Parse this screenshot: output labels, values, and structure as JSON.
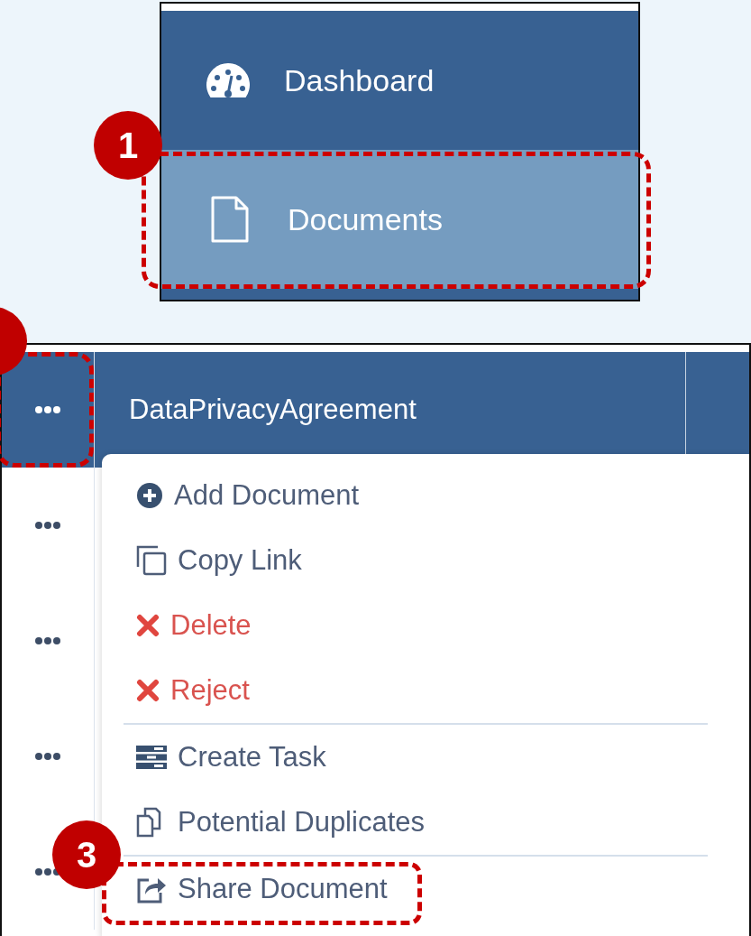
{
  "nav": {
    "items": [
      {
        "label": "Dashboard",
        "selected": false
      },
      {
        "label": "Documents",
        "selected": true,
        "callout": "1"
      }
    ]
  },
  "table": {
    "rows": [
      {
        "selected": true,
        "highlighted": true,
        "name": "DataPrivacyAgreement"
      },
      {
        "selected": false,
        "highlighted": false
      },
      {
        "selected": false,
        "highlighted": false
      },
      {
        "selected": false,
        "highlighted": false
      },
      {
        "selected": false,
        "highlighted": false
      }
    ]
  },
  "menu": {
    "items": [
      {
        "kind": "item",
        "label": "Add Document"
      },
      {
        "kind": "item",
        "label": "Copy Link"
      },
      {
        "kind": "danger",
        "label": "Delete"
      },
      {
        "kind": "danger",
        "label": "Reject"
      },
      {
        "kind": "divider"
      },
      {
        "kind": "item",
        "label": "Create Task"
      },
      {
        "kind": "item",
        "label": "Potential Duplicates"
      },
      {
        "kind": "divider"
      },
      {
        "kind": "item",
        "label": "Share Document",
        "callout": "3"
      }
    ]
  }
}
